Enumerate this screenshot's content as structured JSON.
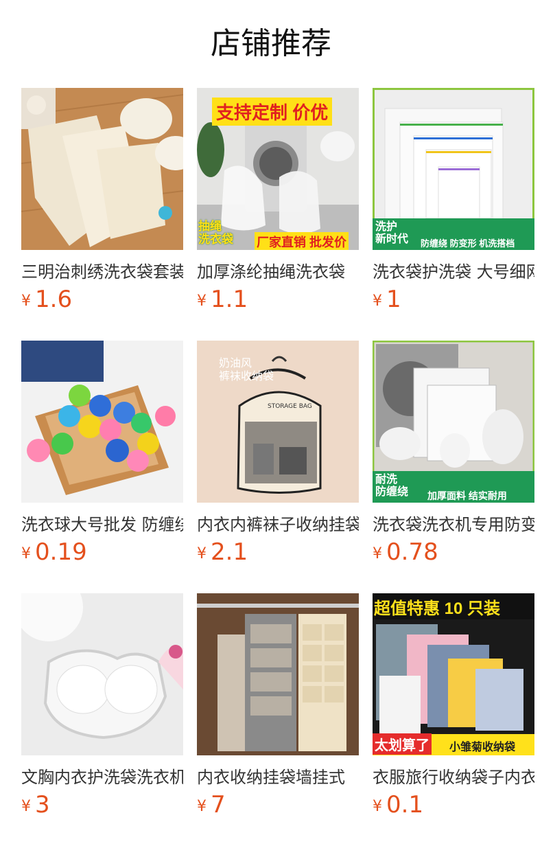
{
  "section": {
    "title": "店铺推荐"
  },
  "currency_symbol": "¥",
  "products": [
    {
      "name": "三明治刺绣洗衣袋套装",
      "price": "1.6",
      "image": "embroidered-laundry-bags",
      "overlay": []
    },
    {
      "name": "加厚涤纶抽绳洗衣袋",
      "price": "1.1",
      "image": "drawstring-laundry-bags",
      "overlay": [
        "支持定制 价优",
        "抽绳",
        "洗衣袋",
        "厂家直销 批发价"
      ]
    },
    {
      "name": "洗衣袋护洗袋 大号细网",
      "price": "1",
      "image": "zipper-mesh-bags",
      "overlay": [
        "洗护",
        "新时代",
        "防缠绕 防变形 机洗搭档"
      ]
    },
    {
      "name": "洗衣球大号批发 防缠绕",
      "price": "0.19",
      "image": "laundry-balls",
      "overlay": []
    },
    {
      "name": "内衣内裤袜子收纳挂袋",
      "price": "2.1",
      "image": "hanging-storage-bag",
      "overlay": [
        "奶油风",
        "裤袜收纳袋"
      ]
    },
    {
      "name": "洗衣袋洗衣机专用防变形",
      "price": "0.78",
      "image": "washing-machine-bags",
      "overlay": [
        "耐洗",
        "防缠绕",
        "加厚面料 结实耐用"
      ]
    },
    {
      "name": "文胸内衣护洗袋洗衣机专用",
      "price": "3",
      "image": "bra-wash-bag",
      "overlay": []
    },
    {
      "name": "内衣收纳挂袋墙挂式",
      "price": "7",
      "image": "wall-hanging-organizer",
      "overlay": []
    },
    {
      "name": "衣服旅行收纳袋子内衣",
      "price": "0.1",
      "image": "daisy-storage-bags",
      "overlay": [
        "超值特惠 10 只装",
        "太划算了",
        "小雏菊收纳袋"
      ]
    }
  ],
  "colors": {
    "price": "#e4501d",
    "title": "#111111",
    "text": "#333333"
  }
}
